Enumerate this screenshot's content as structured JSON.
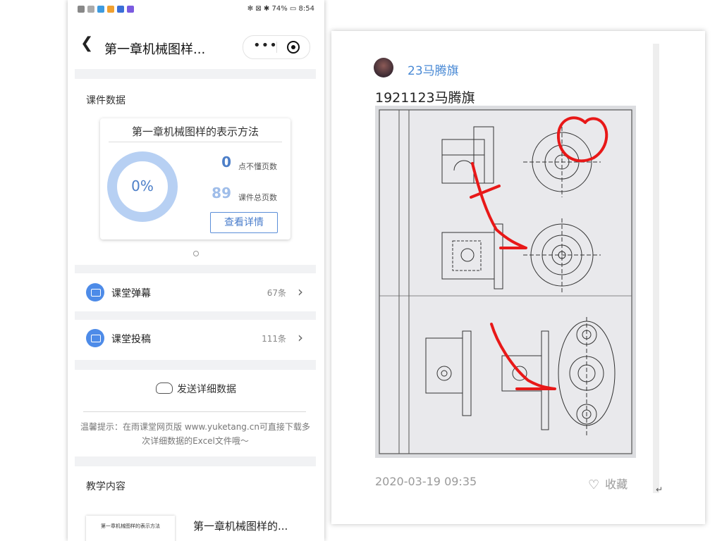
{
  "status": {
    "time": "8:54",
    "battery": "74%"
  },
  "nav": {
    "title": "第一章机械图样...",
    "more": "•••"
  },
  "courseware": {
    "section_label": "课件数据",
    "card_title": "第一章机械图样的表示方法",
    "progress_percent": 0,
    "progress_text": "0%",
    "not_understood_count": "0",
    "not_understood_label": "点不懂页数",
    "total_pages": "89",
    "total_pages_label": "课件总页数",
    "detail_button": "查看详情"
  },
  "rows": [
    {
      "label": "课堂弹幕",
      "count": "67条",
      "icon": "danmaku-icon"
    },
    {
      "label": "课堂投稿",
      "count": "111条",
      "icon": "submission-icon"
    }
  ],
  "send": {
    "label": "发送详细数据",
    "icon": "cloud-upload-icon"
  },
  "tip": "温馨提示：在雨课堂网页版 www.yuketang.cn可直接下载多次详细数据的Excel文件哦～",
  "teaching": {
    "section_label": "教学内容",
    "thumb_text": "第一章机械图样的表示方法",
    "item_title": "第一章机械图样的..."
  },
  "post": {
    "author": "23马腾旗",
    "caption": "1921123马腾旗",
    "date": "2020-03-19 09:35",
    "favorite_label": "收藏",
    "return_mark": "↵",
    "colors": {
      "author": "#4a8ad5",
      "annotation": "#e81818"
    }
  }
}
